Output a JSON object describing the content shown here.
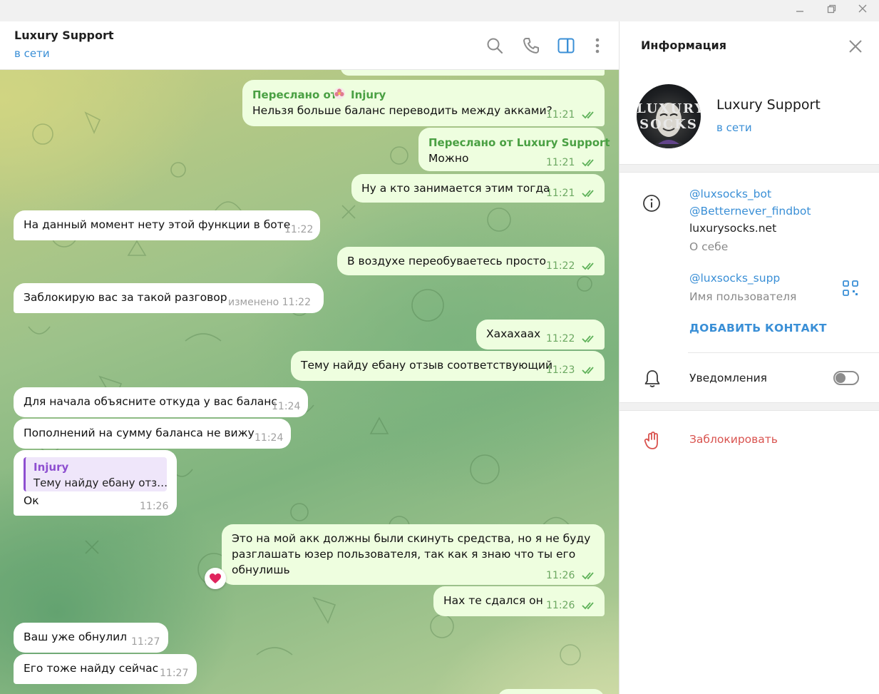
{
  "chat": {
    "title": "Luxury Support",
    "status": "в сети"
  },
  "messages": [
    {
      "id": "m1",
      "fwd_label": "Переслано от",
      "fwd_from": "Injury",
      "text": "Нельзя больше баланс переводить между акками?",
      "time": "11:21"
    },
    {
      "id": "m2",
      "fwd_label": "Переслано от Luxury Support",
      "text": "Можно",
      "time": "11:21"
    },
    {
      "id": "m3",
      "text": "Ну а кто занимается этим тогда",
      "time": "11:21"
    },
    {
      "id": "m4",
      "text": "На данный момент нету этой функции в боте",
      "time": "11:22"
    },
    {
      "id": "m5",
      "text": "В воздухе переобуваетесь просто",
      "time": "11:22"
    },
    {
      "id": "m6",
      "text": "Заблокирую вас за такой разговор",
      "time": "изменено 11:22"
    },
    {
      "id": "m7",
      "text": "Хахахаах",
      "time": "11:22"
    },
    {
      "id": "m8",
      "text": "Тему найду ебану отзыв соответствующий",
      "time": "11:23"
    },
    {
      "id": "m9",
      "text": "Для начала объясните откуда у вас баланс",
      "time": "11:24"
    },
    {
      "id": "m10",
      "text": "Пополнений на сумму баланса не вижу",
      "time": "11:24"
    },
    {
      "id": "m11",
      "reply_name": "Injury",
      "reply_text": "Тему найду ебану отз…",
      "text": "Ок",
      "time": "11:26"
    },
    {
      "id": "m12",
      "lines": [
        "Это на мой акк должны были скинуть средства, но я не буду",
        "разглашать юзер пользователя, так как я знаю что ты его",
        "обнулишь"
      ],
      "time": "11:26",
      "reaction": "❤️"
    },
    {
      "id": "m13",
      "text": "Нах те сдался он",
      "time": "11:26"
    },
    {
      "id": "m14",
      "text": "Ваш уже обнулил",
      "time": "11:27"
    },
    {
      "id": "m15",
      "text": "Его тоже найду сейчас",
      "time": "11:27"
    }
  ],
  "info": {
    "title": "Информация",
    "name": "Luxury Support",
    "status": "в сети",
    "avatar_text": [
      "LUXURY",
      "SOCKS"
    ],
    "bio_lines": [
      "@luxsocks_bot",
      "@Betternever_findbot",
      "luxurysocks.net"
    ],
    "bio_caption": "О себе",
    "username": "@luxsocks_supp",
    "username_caption": "Имя пользователя",
    "add_contact": "ДОБАВИТЬ КОНТАКТ",
    "notifications": "Уведомления",
    "notifications_on": false,
    "block": "Заблокировать"
  },
  "colors": {
    "accent": "#3a8fd6",
    "outgoing_bubble": "#eefedf",
    "check_green": "#5fb25a",
    "forward_green": "#4aa043",
    "danger": "#d9534f",
    "reply_purple": "#8e4fd0"
  },
  "icons": {
    "search": "search-icon",
    "call": "phone-icon",
    "side_panel": "sidebar-toggle-icon",
    "more": "more-vertical-icon",
    "close": "close-icon",
    "info": "info-icon",
    "qr": "qr-code-icon",
    "bell": "bell-icon",
    "block": "hand-stop-icon"
  }
}
